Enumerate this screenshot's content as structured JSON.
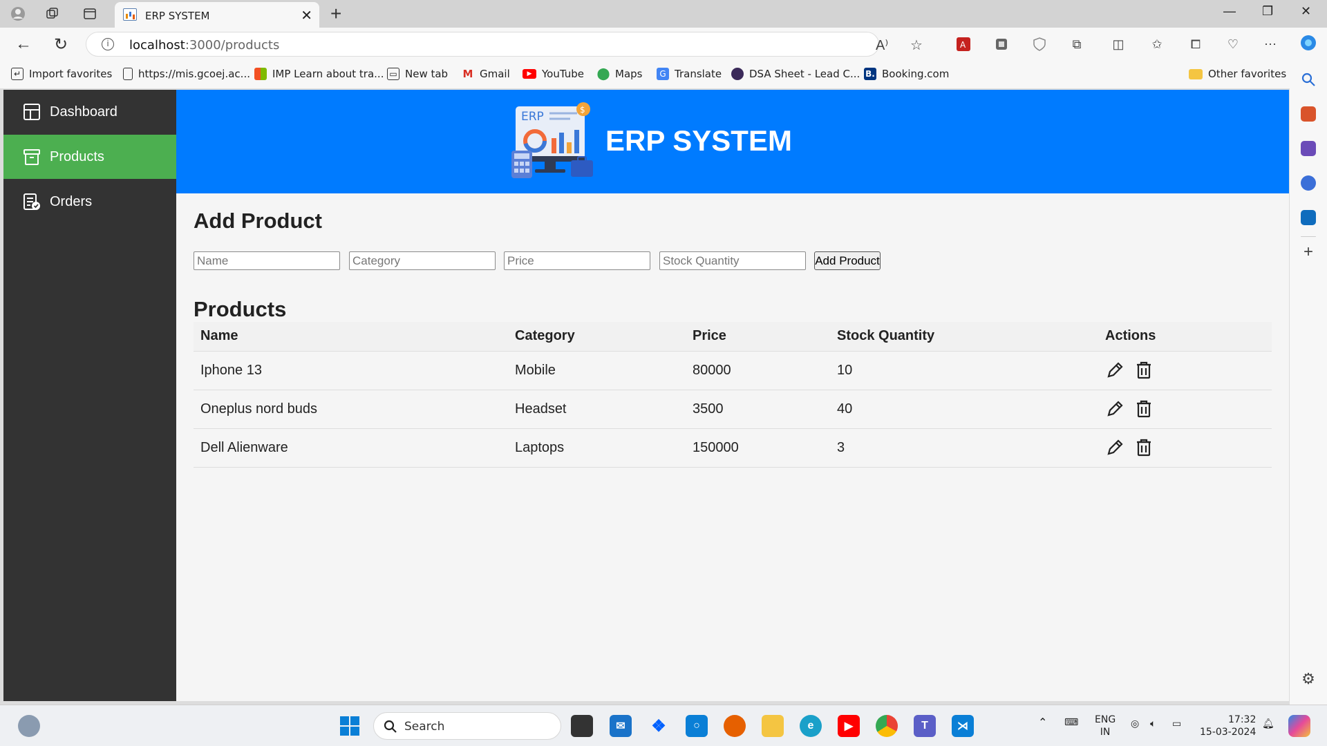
{
  "browser": {
    "tab_title": "ERP SYSTEM",
    "url_host": "localhost",
    "url_path": ":3000/products",
    "bookmarks": [
      {
        "label": "Import favorites",
        "icon": "import-icon"
      },
      {
        "label": "https://mis.gcoej.ac...",
        "icon": "page-icon"
      },
      {
        "label": "IMP Learn about tra...",
        "icon": "microsoft-icon"
      },
      {
        "label": "New tab",
        "icon": "newtab-icon"
      },
      {
        "label": "Gmail",
        "icon": "gmail-icon"
      },
      {
        "label": "YouTube",
        "icon": "youtube-icon"
      },
      {
        "label": "Maps",
        "icon": "maps-icon"
      },
      {
        "label": "Translate",
        "icon": "translate-icon"
      },
      {
        "label": "DSA Sheet - Lead C...",
        "icon": "dsa-icon"
      },
      {
        "label": "Booking.com",
        "icon": "booking-icon"
      }
    ],
    "other_favorites": "Other favorites"
  },
  "sidebar": {
    "items": [
      {
        "label": "Dashboard",
        "icon": "dashboard-icon",
        "active": false
      },
      {
        "label": "Products",
        "icon": "products-icon",
        "active": true
      },
      {
        "label": "Orders",
        "icon": "orders-icon",
        "active": false
      }
    ]
  },
  "header": {
    "brand": "ERP SYSTEM",
    "logo_text": "ERP"
  },
  "form": {
    "title": "Add Product",
    "name_placeholder": "Name",
    "category_placeholder": "Category",
    "price_placeholder": "Price",
    "stock_placeholder": "Stock Quantity",
    "submit_label": "Add Product"
  },
  "products": {
    "title": "Products",
    "columns": [
      "Name",
      "Category",
      "Price",
      "Stock Quantity",
      "Actions"
    ],
    "rows": [
      {
        "name": "Iphone 13",
        "category": "Mobile",
        "price": "80000",
        "stock": "10"
      },
      {
        "name": "Oneplus nord buds",
        "category": "Headset",
        "price": "3500",
        "stock": "40"
      },
      {
        "name": "Dell Alienware",
        "category": "Laptops",
        "price": "150000",
        "stock": "3"
      }
    ]
  },
  "taskbar": {
    "search_label": "Search",
    "lang_top": "ENG",
    "lang_bottom": "IN",
    "time": "17:32",
    "date": "15-03-2024"
  },
  "colors": {
    "header_blue": "#007bff",
    "sidebar_dark": "#333333",
    "active_green": "#4caf50"
  }
}
